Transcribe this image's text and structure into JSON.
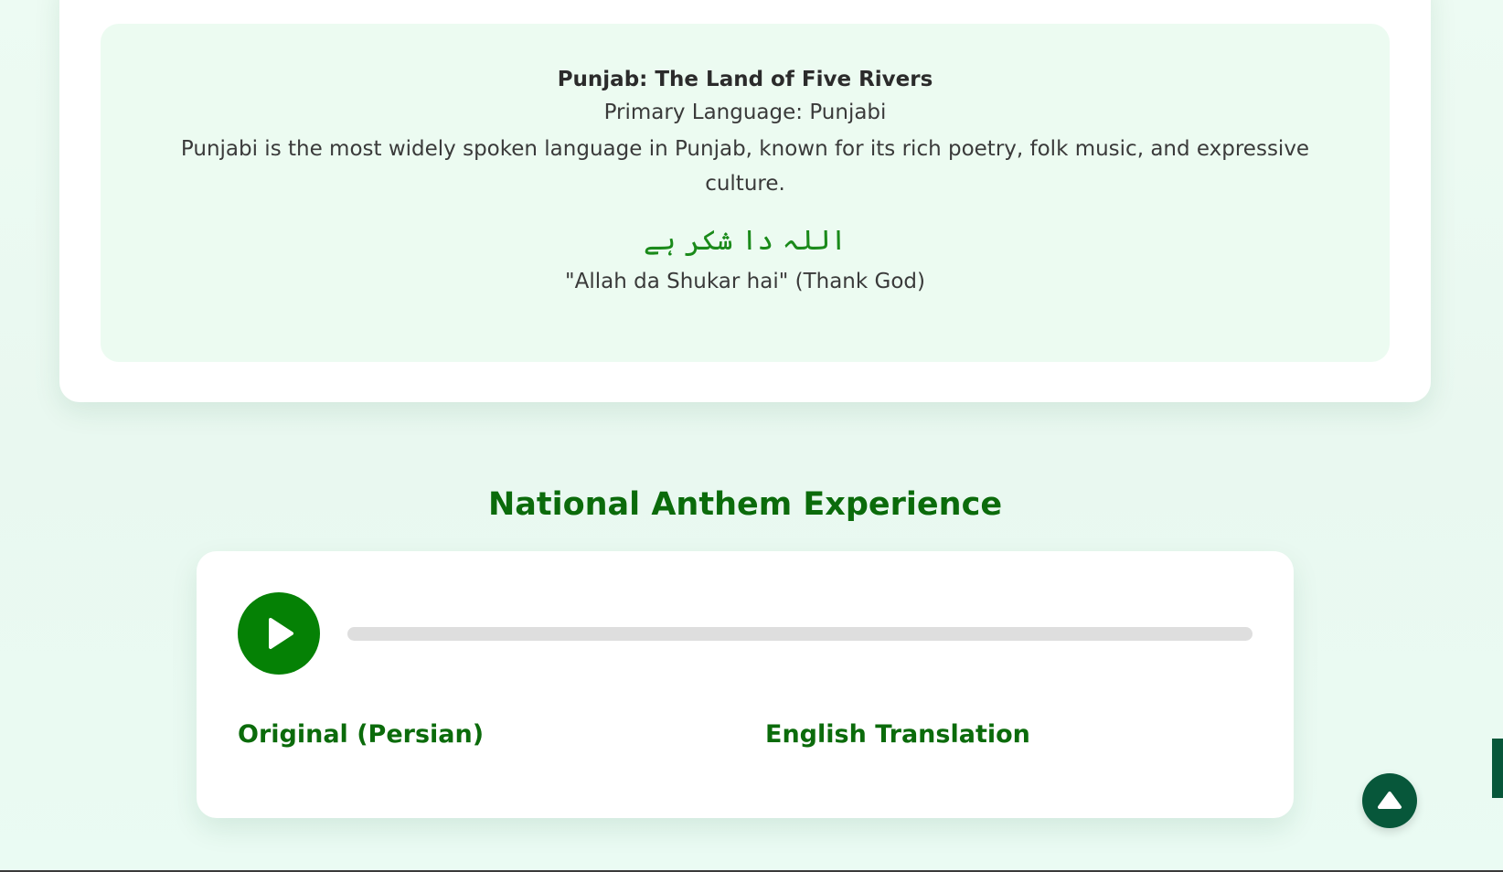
{
  "colors": {
    "accent_green": "#058105",
    "heading_green": "#0b6b0b",
    "dark_teal": "#07573a",
    "card_tint": "#ecfbf1"
  },
  "region_card": {
    "title": "Punjab: The Land of Five Rivers",
    "primary_language": "Primary Language: Punjabi",
    "description": "Punjabi is the most widely spoken language in Punjab, known for its rich poetry, folk music, and expressive culture.",
    "native_phrase": "اللہ دا شکر ہے",
    "transliteration": "\"Allah da Shukar hai\" (Thank God)"
  },
  "anthem": {
    "section_title": "National Anthem Experience",
    "play_icon": "play-icon",
    "progress": 0,
    "original_heading": "Original (Persian)",
    "translation_heading": "English Translation"
  },
  "floating": {
    "scroll_top_icon": "chevron-up-icon"
  }
}
